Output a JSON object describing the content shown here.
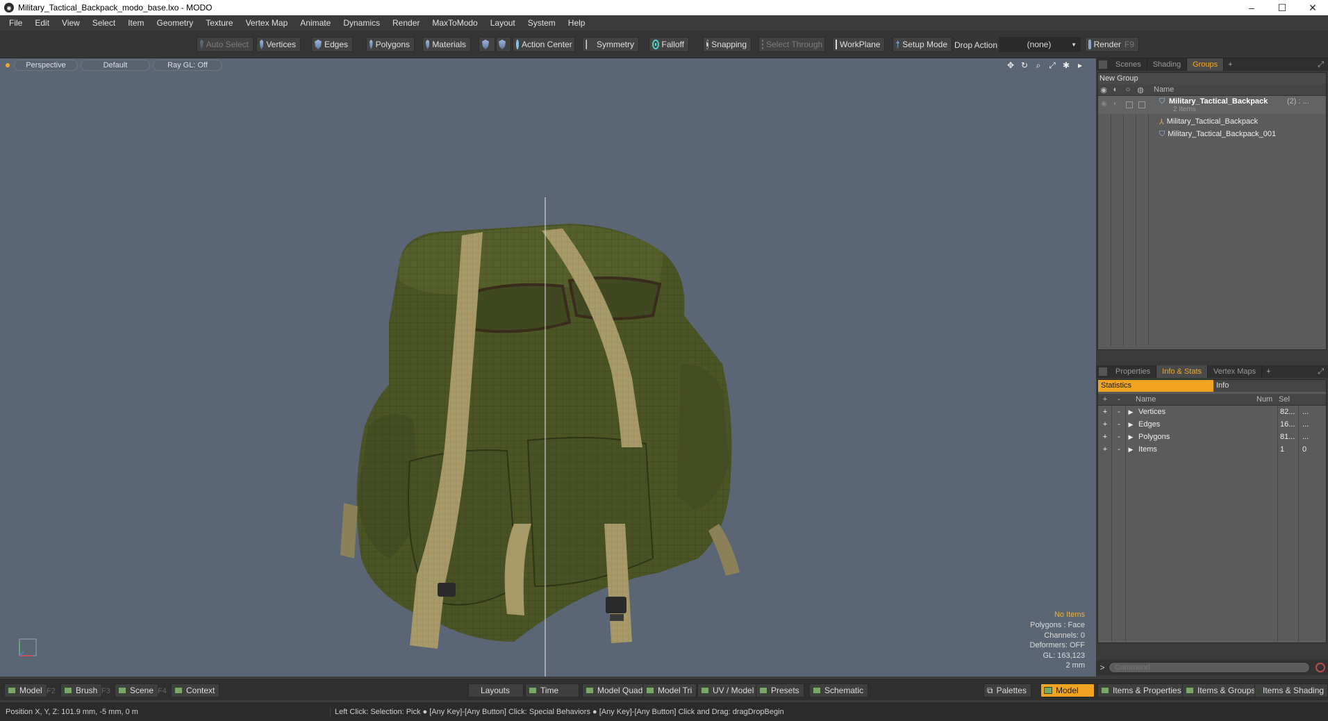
{
  "window": {
    "title": "Military_Tactical_Backpack_modo_base.lxo - MODO",
    "minimize": "–",
    "maximize": "☐",
    "close": "✕"
  },
  "menu": [
    "File",
    "Edit",
    "View",
    "Select",
    "Item",
    "Geometry",
    "Texture",
    "Vertex Map",
    "Animate",
    "Dynamics",
    "Render",
    "MaxToModo",
    "Layout",
    "System",
    "Help"
  ],
  "toolbar": {
    "auto_select": "Auto Select",
    "vertices": "Vertices",
    "edges": "Edges",
    "polygons": "Polygons",
    "materials": "Materials",
    "action_center": "Action Center",
    "symmetry": "Symmetry",
    "falloff": "Falloff",
    "snapping": "Snapping",
    "select_through": "Select Through",
    "workplane": "WorkPlane",
    "setup_mode": "Setup Mode",
    "drop_action_label": "Drop Action",
    "drop_action_value": "(none)",
    "render": "Render",
    "render_key": "F9"
  },
  "viewport": {
    "view": "Perspective",
    "shading": "Default",
    "raygl": "Ray GL: Off",
    "overlay": {
      "items": "No Items",
      "polygons": "Polygons : Face",
      "channels": "Channels: 0",
      "deformers": "Deformers: OFF",
      "gl": "GL: 163,123",
      "scale": "2 mm"
    }
  },
  "top_panel": {
    "tabs": [
      "Scenes",
      "Shading",
      "Groups"
    ],
    "active_tab": "Groups",
    "new_group": "New Group",
    "name_header": "Name",
    "group_name": "Military_Tactical_Backpack",
    "group_count": "(2) : ...",
    "group_sub": "2 Items",
    "children": [
      "Military_Tactical_Backpack",
      "Military_Tactical_Backpack_001"
    ]
  },
  "bottom_panel": {
    "tabs": [
      "Properties",
      "Info & Stats",
      "Vertex Maps"
    ],
    "active_tab": "Info & Stats",
    "subtabs": [
      "Statistics",
      "Info"
    ],
    "headers": {
      "name": "Name",
      "num": "Num",
      "sel": "Sel"
    },
    "rows": [
      {
        "name": "Vertices",
        "num": "82...",
        "sel": "..."
      },
      {
        "name": "Edges",
        "num": "16...",
        "sel": "..."
      },
      {
        "name": "Polygons",
        "num": "81...",
        "sel": "..."
      },
      {
        "name": "Items",
        "num": "1",
        "sel": "0"
      }
    ],
    "command_placeholder": "Command"
  },
  "bottombar": {
    "model": "Model",
    "model_key": "F2",
    "brush": "Brush",
    "brush_key": "F3",
    "scene": "Scene",
    "scene_key": "F4",
    "context": "Context",
    "layouts": "Layouts",
    "time": "Time",
    "model_quad": "Model Quad",
    "model_tri": "Model Tri",
    "uv_model": "UV / Model",
    "presets": "Presets",
    "schematic": "Schematic",
    "palettes": "Palettes",
    "model_active": "Model",
    "items_properties": "Items & Properties",
    "items_groups": "Items & Groups",
    "items_shading": "Items & Shading"
  },
  "status": {
    "position": "Position X, Y, Z:   101.9 mm, -5 mm, 0 m",
    "hint": "Left Click: Selection: Pick ● [Any Key]-[Any Button] Click: Special Behaviors ● [Any Key]-[Any Button] Click and Drag: dragDropBegin"
  }
}
